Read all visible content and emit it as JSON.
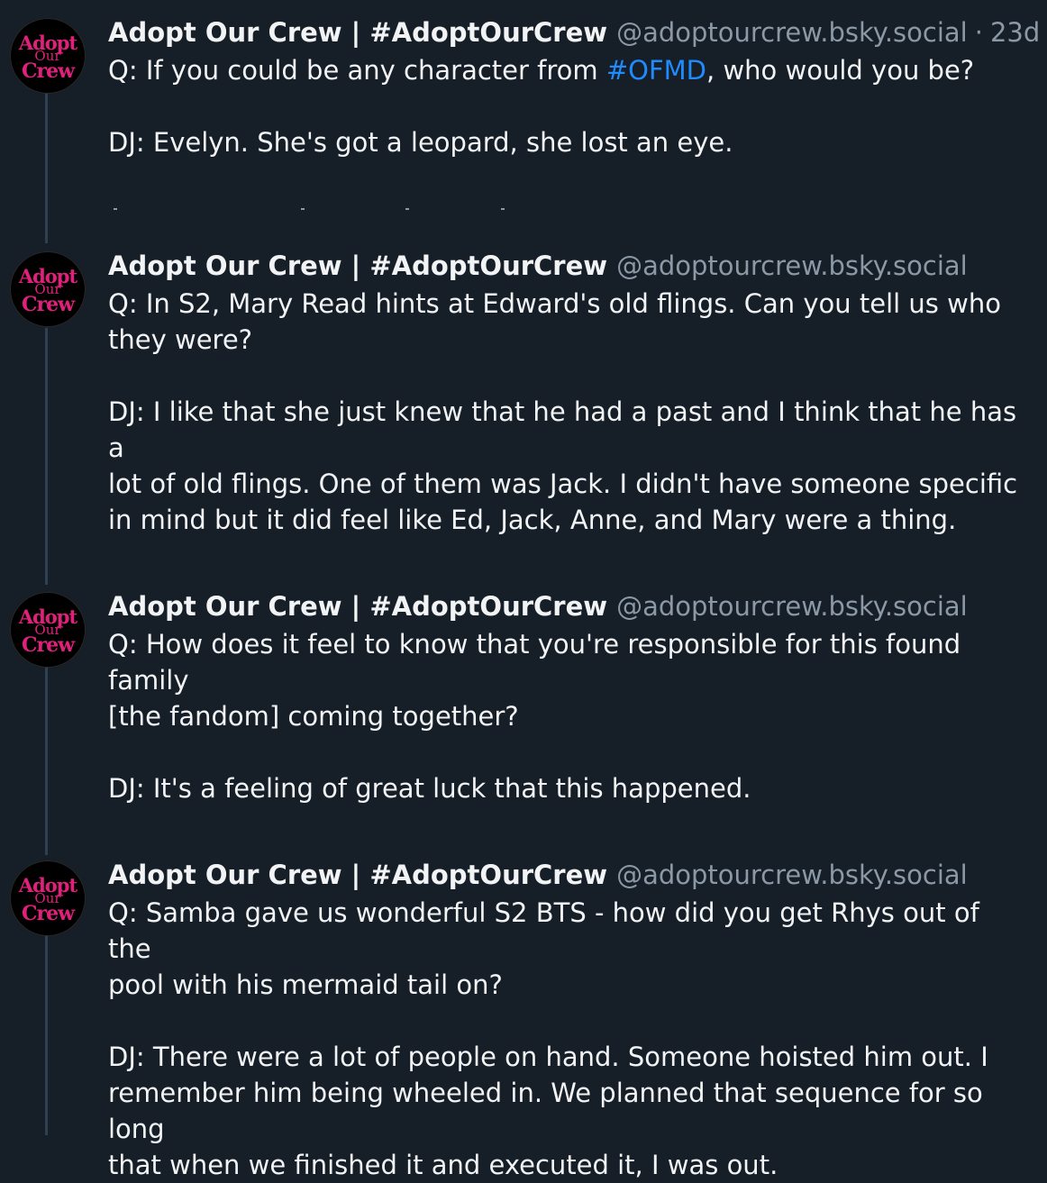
{
  "posts": [
    {
      "author": {
        "avatar_text": [
          "Adopt",
          "Our",
          "Crew"
        ],
        "display_name": "Adopt Our Crew | #AdoptOurCrew",
        "handle": "@adoptourcrew.bsky.social"
      },
      "time": "23d",
      "question_pre": "Q: If you could be any character from ",
      "hashtag": "#OFMD",
      "question_post": ", who would you be?",
      "answer": "DJ: Evelyn. She's got a leopard, she lost an eye."
    },
    {
      "author": {
        "avatar_text": [
          "Adopt",
          "Our",
          "Crew"
        ],
        "display_name": "Adopt Our Crew | #AdoptOurCrew",
        "handle": "@adoptourcrew.bsky.social"
      },
      "question_lines": [
        "Q: In S2, Mary Read hints at Edward's old flings. Can you tell us who",
        "they were?"
      ],
      "answer_lines": [
        "DJ: I like that she just knew that he had a past and I think that he has a",
        "lot of old flings. One of them was Jack. I didn't have someone specific",
        "in mind but it did feel like Ed, Jack, Anne, and Mary were a thing."
      ]
    },
    {
      "author": {
        "avatar_text": [
          "Adopt",
          "Our",
          "Crew"
        ],
        "display_name": "Adopt Our Crew | #AdoptOurCrew",
        "handle": "@adoptourcrew.bsky.social"
      },
      "question_lines": [
        "Q: How does it feel to know that you're responsible for this found family",
        "[the fandom] coming together?"
      ],
      "answer_lines": [
        "DJ: It's a feeling of great luck that this happened."
      ]
    },
    {
      "author": {
        "avatar_text": [
          "Adopt",
          "Our",
          "Crew"
        ],
        "display_name": "Adopt Our Crew | #AdoptOurCrew",
        "handle": "@adoptourcrew.bsky.social"
      },
      "question_lines": [
        "Q: Samba gave us wonderful S2 BTS - how did you get Rhys out of the",
        "pool with his mermaid tail on?"
      ],
      "answer_lines": [
        "DJ: There were a lot of people on hand. Someone hoisted him out. I",
        "remember him being wheeled in. We planned that sequence for so long",
        "that when we finished it and executed it, I was out."
      ]
    }
  ],
  "separator": "·",
  "colors": {
    "background": "#161e27",
    "text": "#f1f3f5",
    "muted": "#8b98a5",
    "hashtag": "#208bfe",
    "thread_line": "#2e4052",
    "avatar_brand": "#e0207a"
  }
}
